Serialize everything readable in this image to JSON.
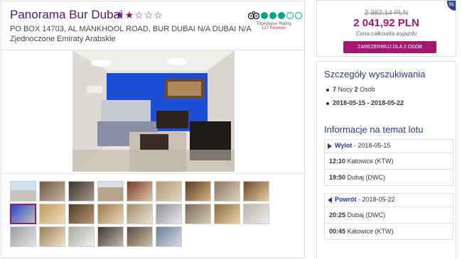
{
  "hotel": {
    "name": "Panorama Bur Dubai",
    "stars_filled": 2,
    "stars_total": 5,
    "address_line1": "PO BOX 14703, AL MANKHOOL ROAD, BUR DUBAI N/A DUBAI N/A",
    "address_line2": "Zjednoczone Emiraty Arabskie"
  },
  "tripadvisor": {
    "label": "TripAdvisor Rating",
    "reviews": "127 Reviews",
    "bubbles_filled": 3,
    "bubbles_total": 5,
    "icon": "owl-icon",
    "color": "#00a680"
  },
  "gallery": {
    "thumbnail_count": 24,
    "selected_index": 9
  },
  "price": {
    "old": "2 382,14 PLN",
    "new": "2 041,92 PLN",
    "note": "Cena całkowita wyjazdu",
    "book_label": "ZAREZERWUJ DLA 2 OSÓB",
    "corner_glyph": "%",
    "accent": "#a3186e"
  },
  "search": {
    "title": "Szczegóły wyszukiwania",
    "nights_count": "7",
    "nights_label": "Nocy",
    "persons_count": "2",
    "persons_label": "Osób",
    "dates": "2018-05-15 - 2018-05-22"
  },
  "flight": {
    "title": "Informacje na temat lotu",
    "outbound": {
      "label": "Wylot",
      "date": " - 2018-05-15",
      "rows": [
        {
          "time": "12:10",
          "place": " Katowice (KTW)"
        },
        {
          "time": "19:50",
          "place": " Dubaj (DWC)"
        }
      ]
    },
    "return": {
      "label": "Powrót",
      "date": " - 2018-05-22",
      "rows": [
        {
          "time": "20:25",
          "place": " Dubaj (DWC)"
        },
        {
          "time": "00:45",
          "place": " Katowice (KTW)"
        }
      ]
    }
  }
}
